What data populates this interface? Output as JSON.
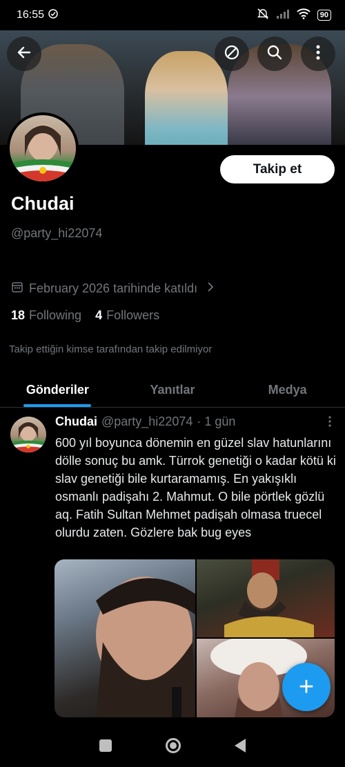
{
  "status_bar": {
    "time": "16:55",
    "battery": "90"
  },
  "banner": {
    "back_icon": "arrow-left-icon",
    "slash_icon": "circle-slash-icon",
    "search_icon": "search-icon",
    "more_icon": "more-vertical-icon"
  },
  "profile": {
    "follow_label": "Takip et",
    "display_name": "Chudai",
    "handle": "@party_hi22074",
    "joined": "February 2026 tarihinde katıldı",
    "following_count": "18",
    "following_label": "Following",
    "followers_count": "4",
    "followers_label": "Followers",
    "mutual_text": "Takip ettiğin kimse tarafından takip edilmiyor"
  },
  "tabs": [
    {
      "label": "Gönderiler",
      "active": true
    },
    {
      "label": "Yanıtlar",
      "active": false
    },
    {
      "label": "Medya",
      "active": false
    }
  ],
  "post": {
    "name": "Chudai",
    "handle": "@party_hi22074",
    "time": "· 1 gün",
    "text": "600 yıl boyunca dönemin en güzel slav hatunlarını dölle sonuç bu amk. Türrok genetiği o kadar kötü ki slav genetiği bile kurtaramamış. En yakışıklı osmanlı padişahı 2. Mahmut. O bile pörtlek gözlü aq. Fatih Sultan Mehmet padişah olmasa truecel olurdu zaten. Gözlere bak bug eyes"
  },
  "fab": {
    "label": "+"
  },
  "colors": {
    "accent": "#1d9bf0",
    "background": "#000000",
    "secondary_text": "#71767b"
  }
}
